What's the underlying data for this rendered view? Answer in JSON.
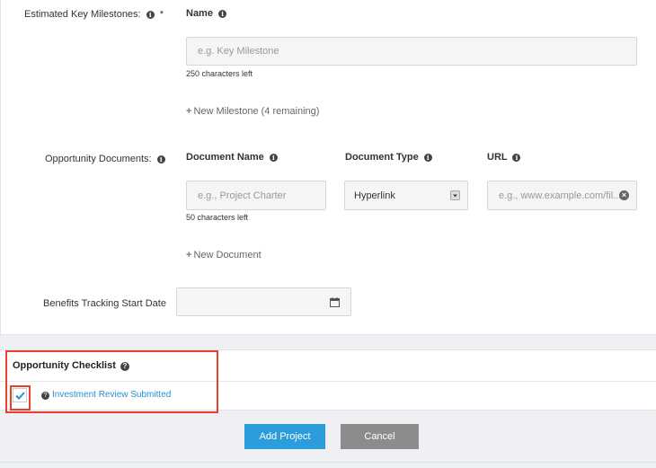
{
  "milestones": {
    "label": "Estimated Key Milestones:",
    "required_mark": "*",
    "name_header": "Name",
    "name_placeholder": "e.g. Key Milestone",
    "chars_left": "250 characters left",
    "add_label": "New Milestone (4 remaining)"
  },
  "documents": {
    "label": "Opportunity Documents:",
    "col_name": "Document Name",
    "col_type": "Document Type",
    "col_url": "URL",
    "name_placeholder": "e.g., Project Charter",
    "chars_left": "50 characters left",
    "type_value": "Hyperlink",
    "url_placeholder": "e.g., www.example.com/fil...",
    "add_label": "New Document"
  },
  "benefits": {
    "label": "Benefits Tracking Start Date",
    "date_value": ""
  },
  "checklist": {
    "title": "Opportunity Checklist",
    "item_label": "Investment Review Submitted",
    "item_checked": true
  },
  "actions": {
    "add_project": "Add Project",
    "cancel": "Cancel"
  },
  "colors": {
    "primary_button": "#2d9cdb",
    "cancel_button": "#8c8c8c",
    "link": "#2a8ed6",
    "highlight": "#e8402a"
  }
}
